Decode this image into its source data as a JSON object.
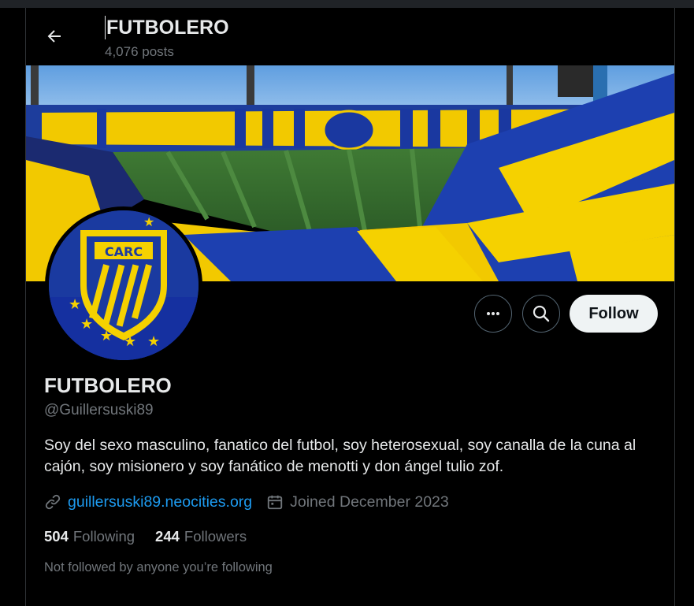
{
  "header": {
    "title": "FUTBOLERO",
    "post_count": "4,076 posts",
    "back_icon": "arrow-left-icon"
  },
  "banner": {
    "avatar_text": "CARC"
  },
  "actions": {
    "more_icon": "more-horizontal-icon",
    "search_icon": "search-icon",
    "follow_label": "Follow"
  },
  "profile": {
    "display_name": "FUTBOLERO",
    "handle": "@Guillersuski89",
    "bio": "Soy del sexo masculino, fanatico del futbol, soy heterosexual, soy canalla de la cuna al cajón, soy misionero y soy fanático de menotti y don ángel tulio zof.",
    "website": "guillersuski89.neocities.org",
    "joined": "Joined December 2023",
    "following_count": "504",
    "following_label": "Following",
    "followers_count": "244",
    "followers_label": "Followers",
    "not_followed_text": "Not followed by anyone you’re following"
  },
  "colors": {
    "background": "#000000",
    "text_primary": "#e7e9ea",
    "text_secondary": "#71767b",
    "link": "#1d9bf0",
    "follow_button_bg": "#eff3f4",
    "club_blue": "#1a3aa0",
    "club_yellow": "#f5d100"
  }
}
